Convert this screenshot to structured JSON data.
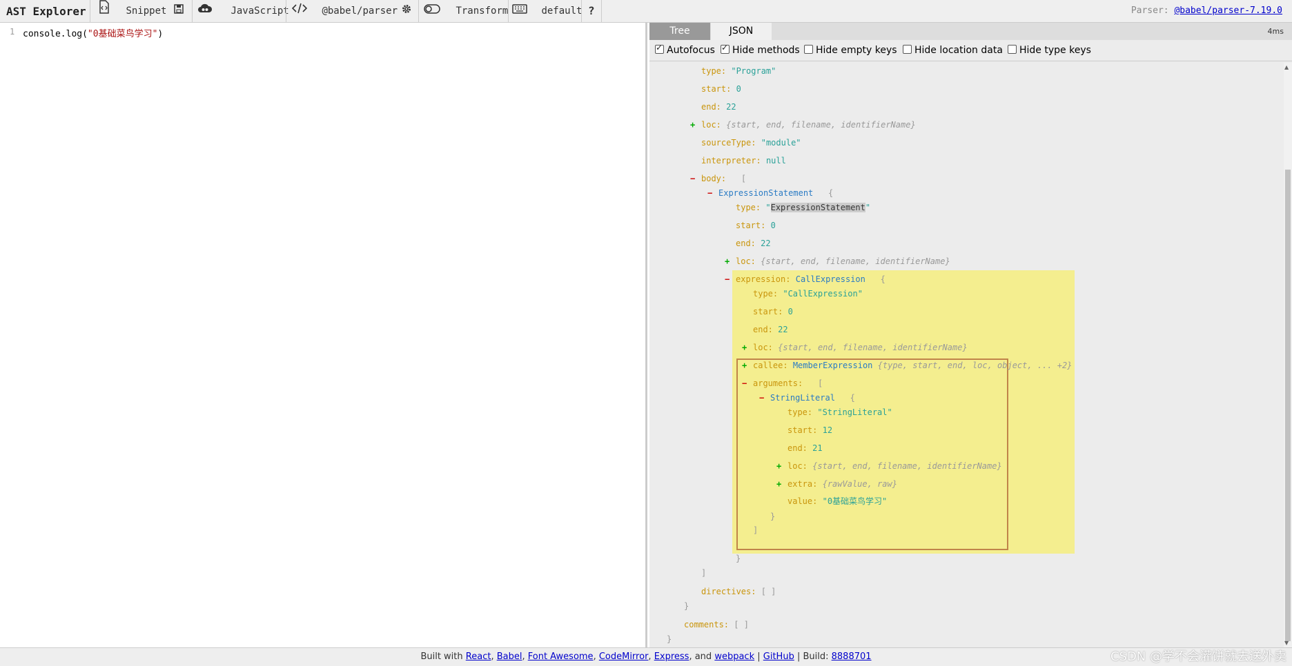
{
  "toolbar": {
    "title": "AST Explorer",
    "snippet": "Snippet",
    "language": "JavaScript",
    "parser": "@babel/parser",
    "transform": "Transform",
    "keymap": "default",
    "help": "?",
    "parser_info_label": "Parser:",
    "parser_info_link": "@babel/parser-7.19.0"
  },
  "editor": {
    "line_number": "1",
    "code_prefix": "console.log(",
    "code_string": "\"0基础菜鸟学习\"",
    "code_suffix": ")"
  },
  "panel": {
    "tab_tree": "Tree",
    "tab_json": "JSON",
    "timing": "4ms",
    "options": [
      {
        "label": "Autofocus",
        "checked": true
      },
      {
        "label": "Hide methods",
        "checked": true
      },
      {
        "label": "Hide empty keys",
        "checked": false
      },
      {
        "label": "Hide location data",
        "checked": false
      },
      {
        "label": "Hide type keys",
        "checked": false
      }
    ]
  },
  "tree": {
    "program": {
      "type_key": "type:",
      "type_val": "\"Program\"",
      "start_key": "start:",
      "start_val": "0",
      "end_key": "end:",
      "end_val": "22",
      "loc_key": "loc:",
      "loc_meta": "{start, end, filename, identifierName}",
      "sourceType_key": "sourceType:",
      "sourceType_val": "\"module\"",
      "interpreter_key": "interpreter:",
      "interpreter_val": "null",
      "body_key": "body:",
      "body_open": "[",
      "directives_key": "directives:",
      "directives_val": "[ ]",
      "comments_key": "comments:",
      "comments_val": "[ ]"
    },
    "expr_stmt": {
      "name": "ExpressionStatement",
      "open": "{",
      "type_key": "type:",
      "type_val": "ExpressionStatement",
      "start_key": "start:",
      "start_val": "0",
      "end_key": "end:",
      "end_val": "22",
      "loc_key": "loc:",
      "loc_meta": "{start, end, filename, identifierName}",
      "expression_key": "expression:",
      "expression_node": "CallExpression",
      "expression_open": "{"
    },
    "call_expr": {
      "type_key": "type:",
      "type_val": "\"CallExpression\"",
      "start_key": "start:",
      "start_val": "0",
      "end_key": "end:",
      "end_val": "22",
      "loc_key": "loc:",
      "loc_meta": "{start, end, filename, identifierName}",
      "callee_key": "callee:",
      "callee_node": "MemberExpression",
      "callee_meta": "{type, start, end, loc, object, ... +2}",
      "arguments_key": "arguments:",
      "arguments_open": "["
    },
    "string_lit": {
      "name": "StringLiteral",
      "open": "{",
      "type_key": "type:",
      "type_val": "\"StringLiteral\"",
      "start_key": "start:",
      "start_val": "12",
      "end_key": "end:",
      "end_val": "21",
      "loc_key": "loc:",
      "loc_meta": "{start, end, filename, identifierName}",
      "extra_key": "extra:",
      "extra_meta": "{rawValue, raw}",
      "value_key": "value:",
      "value_val": "\"0基础菜鸟学习\""
    },
    "close_brace": "}",
    "close_bracket": "]"
  },
  "footer": {
    "prefix": "Built with",
    "links": [
      "React",
      "Babel",
      "Font Awesome",
      "CodeMirror",
      "Express",
      "webpack"
    ],
    "and": "and",
    "github": "GitHub",
    "build_label": "Build:",
    "build_id": "8888701"
  },
  "watermark": "CSDN @学不会灌饼就去送外卖"
}
